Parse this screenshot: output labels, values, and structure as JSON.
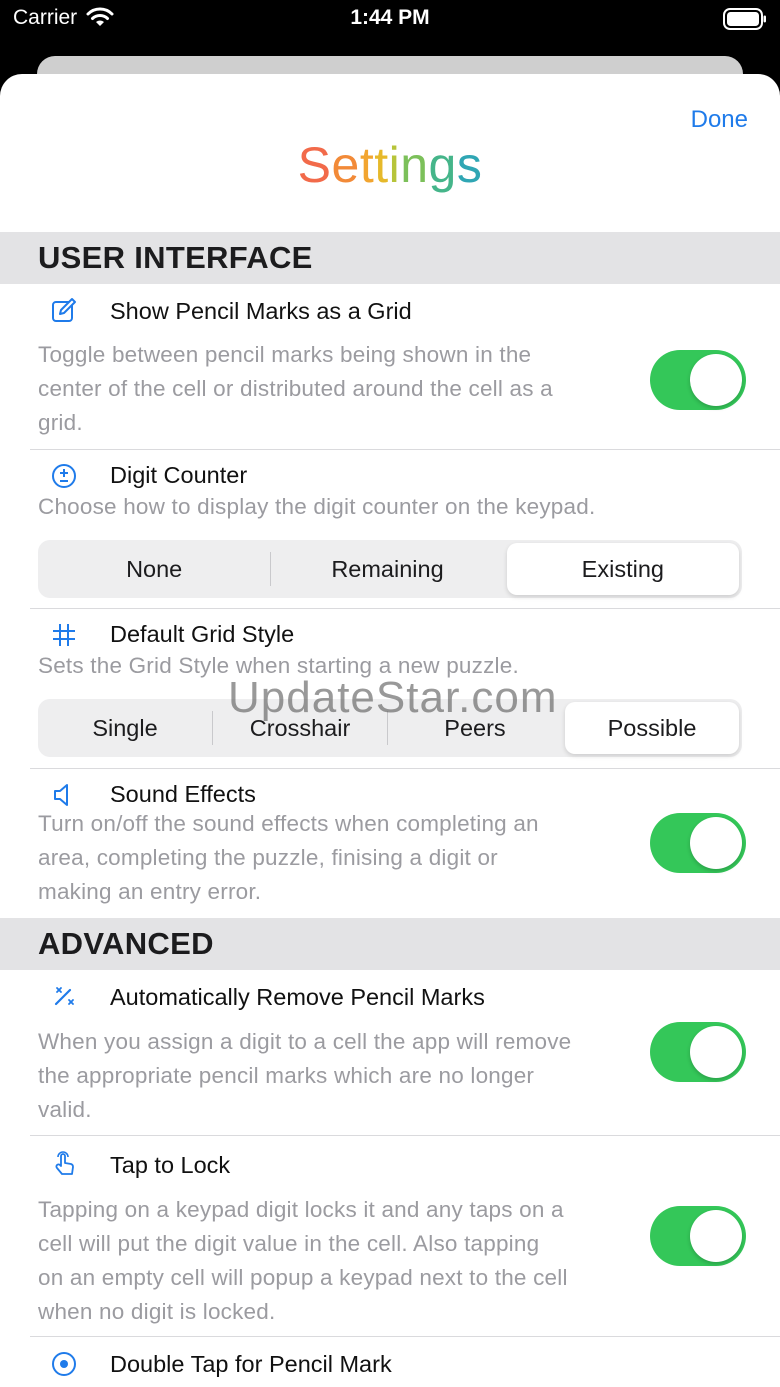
{
  "status_bar": {
    "carrier": "Carrier",
    "time": "1:44 PM"
  },
  "header": {
    "done_label": "Done",
    "title": "Settings",
    "title_colors": [
      "#f26a4a",
      "#f28a38",
      "#f2a530",
      "#e6b92a",
      "#b7c43a",
      "#7cc05a",
      "#45b58a",
      "#2fa6b4",
      "#2f96cc"
    ]
  },
  "sections": {
    "user_interface": {
      "label": "USER INTERFACE",
      "pencil_grid": {
        "title": "Show Pencil Marks as a Grid",
        "desc": [
          "Toggle between pencil marks being shown in the",
          "center of the cell or distributed around the cell as a",
          "grid."
        ],
        "enabled": true,
        "icon": "edit-icon"
      },
      "digit_counter": {
        "title": "Digit Counter",
        "desc": "Choose how to display the digit counter on the keypad.",
        "options": [
          "None",
          "Remaining",
          "Existing"
        ],
        "selected": "Existing",
        "icon": "plus-minus-circle-icon"
      },
      "grid_style": {
        "title": "Default Grid Style",
        "desc": "Sets the Grid Style when starting a new puzzle.",
        "options": [
          "Single",
          "Crosshair",
          "Peers",
          "Possible"
        ],
        "selected": "Possible",
        "icon": "grid-hash-icon"
      },
      "sound_effects": {
        "title": "Sound Effects",
        "desc": [
          "Turn on/off the sound effects when completing an",
          "area, completing the puzzle, finising a digit or",
          "making an entry error."
        ],
        "enabled": true,
        "icon": "speaker-icon"
      }
    },
    "advanced": {
      "label": "ADVANCED",
      "auto_remove": {
        "title": "Automatically Remove Pencil Marks",
        "desc": [
          "When you assign a digit to a cell the app will remove",
          "the appropriate pencil marks which are no longer",
          "valid."
        ],
        "enabled": true,
        "icon": "magic-wand-icon"
      },
      "tap_lock": {
        "title": "Tap to Lock",
        "desc": [
          "Tapping on a keypad digit locks it and any taps on a",
          "cell will put the digit value in the cell. Also tapping",
          "on an empty cell will popup a keypad next to the cell",
          "when no digit is locked."
        ],
        "enabled": true,
        "icon": "hand-tap-icon"
      },
      "double_tap": {
        "title": "Double Tap for Pencil Mark",
        "icon": "target-circle-icon"
      }
    }
  },
  "watermark": "UpdateStar.com",
  "colors": {
    "accent": "#1f7bea",
    "toggle_on": "#34c759"
  }
}
